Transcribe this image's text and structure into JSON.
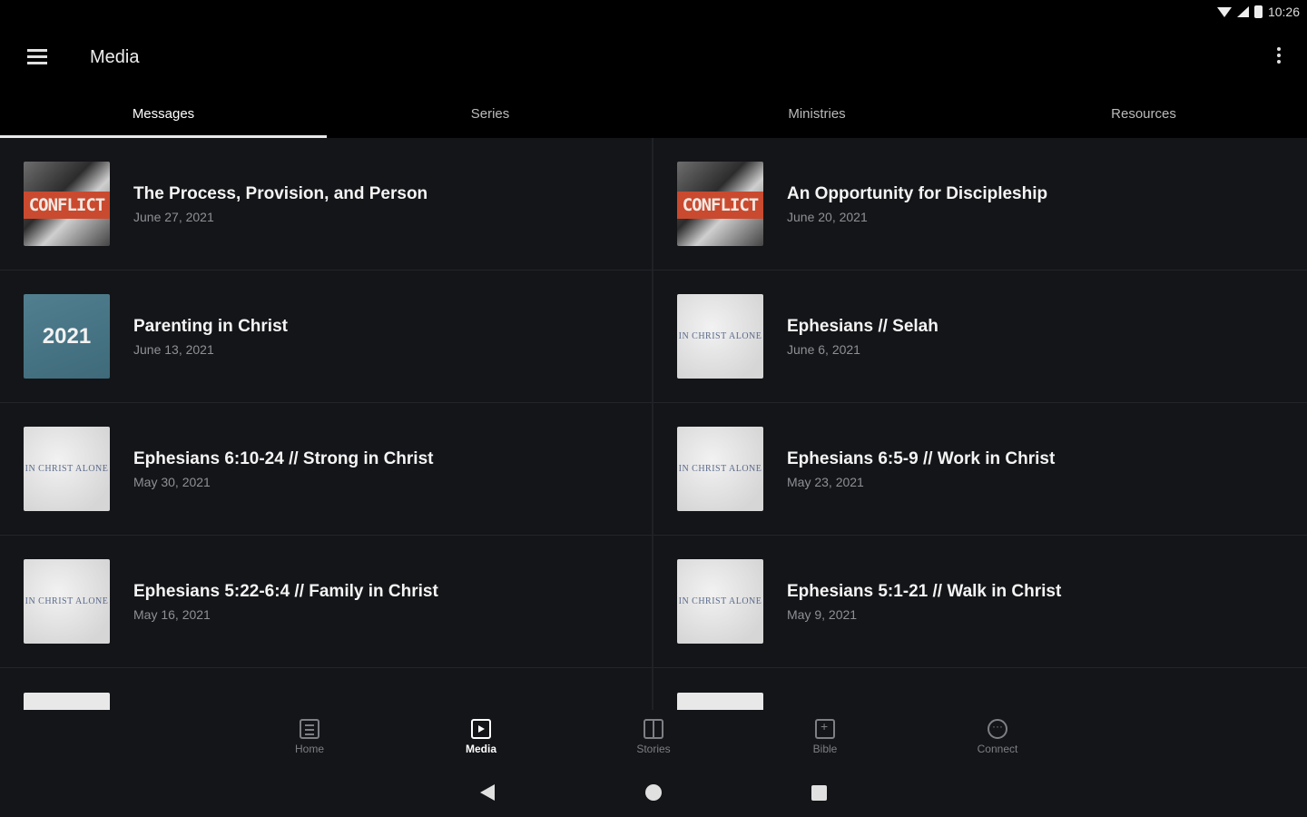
{
  "status": {
    "time": "10:26"
  },
  "appbar": {
    "title": "Media"
  },
  "tabs": [
    {
      "label": "Messages"
    },
    {
      "label": "Series"
    },
    {
      "label": "Ministries"
    },
    {
      "label": "Resources"
    }
  ],
  "items": [
    {
      "title": "The Process, Provision, and Person",
      "date": "June 27, 2021",
      "thumb": "CONFLICT"
    },
    {
      "title": "An Opportunity for Discipleship",
      "date": "June 20, 2021",
      "thumb": "CONFLICT"
    },
    {
      "title": "Parenting in Christ",
      "date": "June 13, 2021",
      "thumb": "2021"
    },
    {
      "title": "Ephesians // Selah",
      "date": "June 6, 2021",
      "thumb": "IN CHRIST ALONE"
    },
    {
      "title": "Ephesians 6:10-24 // Strong in Christ",
      "date": "May 30, 2021",
      "thumb": "IN CHRIST ALONE"
    },
    {
      "title": "Ephesians 6:5-9 // Work in Christ",
      "date": "May 23, 2021",
      "thumb": "IN CHRIST ALONE"
    },
    {
      "title": "Ephesians 5:22-6:4 // Family in Christ",
      "date": "May 16, 2021",
      "thumb": "IN CHRIST ALONE"
    },
    {
      "title": "Ephesians 5:1-21 // Walk in Christ",
      "date": "May 9, 2021",
      "thumb": "IN CHRIST ALONE"
    }
  ],
  "bottomnav": [
    {
      "label": "Home",
      "icon": "home-icon"
    },
    {
      "label": "Media",
      "icon": "media-icon"
    },
    {
      "label": "Stories",
      "icon": "stories-icon"
    },
    {
      "label": "Bible",
      "icon": "bible-icon"
    },
    {
      "label": "Connect",
      "icon": "connect-icon"
    }
  ]
}
